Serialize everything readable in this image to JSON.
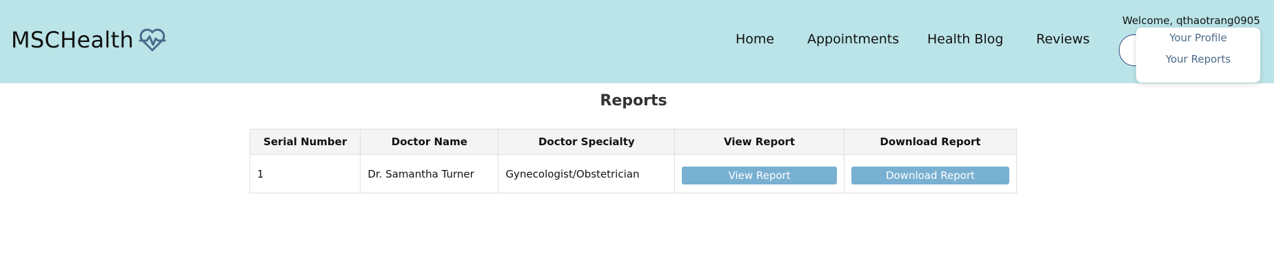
{
  "header": {
    "brand": "MSCHealth",
    "nav": [
      {
        "label": "Home"
      },
      {
        "label": "Appointments"
      },
      {
        "label": "Health Blog"
      },
      {
        "label": "Reviews"
      }
    ],
    "welcome_text": "Welcome, qthaotrang0905",
    "dropdown": [
      {
        "label": "Your Profile"
      },
      {
        "label": "Your Reports"
      }
    ]
  },
  "page": {
    "title": "Reports"
  },
  "table": {
    "headers": [
      "Serial Number",
      "Doctor Name",
      "Doctor Specialty",
      "View Report",
      "Download Report"
    ],
    "rows": [
      {
        "serial": "1",
        "doctor": "Dr. Samantha Turner",
        "specialty": "Gynecologist/Obstetrician",
        "view_label": "View Report",
        "download_label": "Download Report"
      }
    ]
  },
  "colors": {
    "header_bg": "#bae4e8",
    "button_bg": "#78b0d2",
    "dropdown_text": "#4a6a8a",
    "logo_icon": "#4a6a8a"
  },
  "icons": {
    "logo": "heart-pulse-icon"
  }
}
